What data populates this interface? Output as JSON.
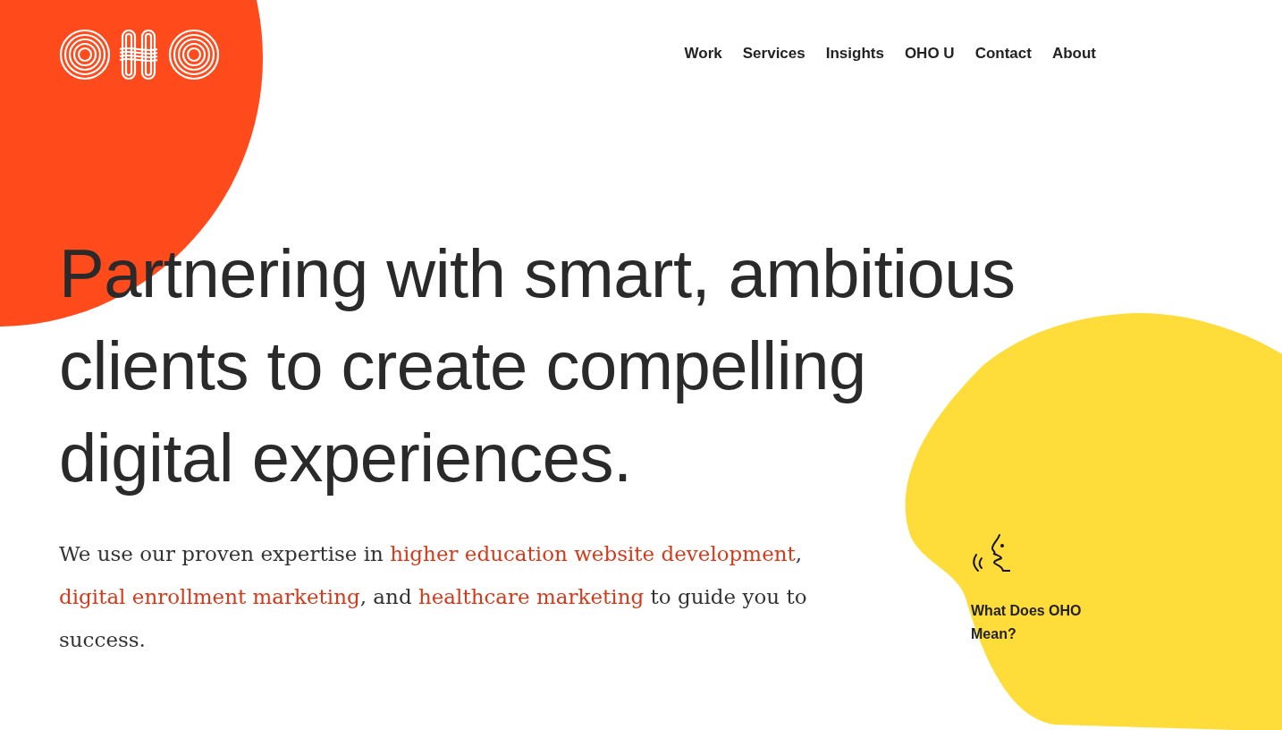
{
  "nav": [
    {
      "label": "Work"
    },
    {
      "label": "Services"
    },
    {
      "label": "Insights"
    },
    {
      "label": "OHO U"
    },
    {
      "label": "Contact"
    },
    {
      "label": "About"
    }
  ],
  "headline": "Partnering with smart, ambitious clients to create compelling digital experiences.",
  "intro": [
    {
      "text": "We use our proven expertise in ",
      "link": false
    },
    {
      "text": "higher education website development",
      "link": true
    },
    {
      "text": ", ",
      "link": false
    },
    {
      "text": "digital enrollment marketing",
      "link": true
    },
    {
      "text": ", and ",
      "link": false
    },
    {
      "text": "healthcare marketing",
      "link": true
    },
    {
      "text": " to guide you to success.",
      "link": false
    }
  ],
  "callout": {
    "label": "What Does OHO Mean?"
  }
}
